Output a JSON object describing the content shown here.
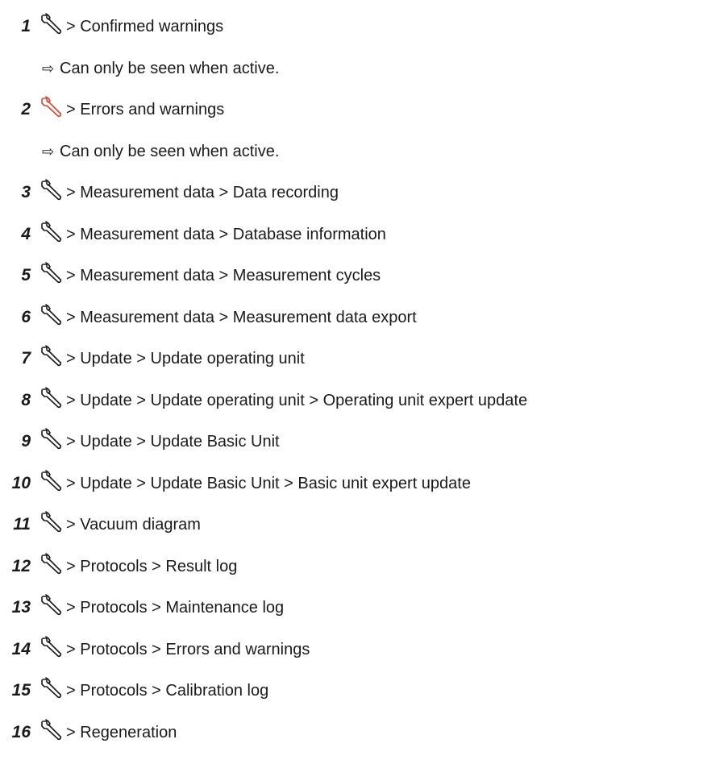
{
  "accent_color": "#d9442f",
  "icon_name": "wrench-icon",
  "separator": ">",
  "note_arrow": "⇨",
  "items": [
    {
      "number": "1",
      "path": "> Confirmed warnings",
      "highlight": false,
      "note": "Can only be seen when active."
    },
    {
      "number": "2",
      "path": "> Errors and warnings",
      "highlight": true,
      "note": "Can only be seen when active."
    },
    {
      "number": "3",
      "path": "> Measurement data > Data recording",
      "highlight": false
    },
    {
      "number": "4",
      "path": "> Measurement data > Database information",
      "highlight": false
    },
    {
      "number": "5",
      "path": "> Measurement data > Measurement cycles",
      "highlight": false
    },
    {
      "number": "6",
      "path": "> Measurement data > Measurement data export",
      "highlight": false
    },
    {
      "number": "7",
      "path": "> Update > Update operating unit",
      "highlight": false
    },
    {
      "number": "8",
      "path": "> Update > Update operating unit > Operating unit expert update",
      "highlight": false
    },
    {
      "number": "9",
      "path": "> Update > Update Basic Unit",
      "highlight": false
    },
    {
      "number": "10",
      "path": "> Update > Update Basic Unit > Basic unit expert update",
      "highlight": false
    },
    {
      "number": "11",
      "path": "> Vacuum diagram",
      "highlight": false
    },
    {
      "number": "12",
      "path": "> Protocols > Result log",
      "highlight": false
    },
    {
      "number": "13",
      "path": "> Protocols > Maintenance log",
      "highlight": false
    },
    {
      "number": "14",
      "path": "> Protocols > Errors and warnings",
      "highlight": false
    },
    {
      "number": "15",
      "path": "> Protocols > Calibration log",
      "highlight": false
    },
    {
      "number": "16",
      "path": "> Regeneration",
      "highlight": false
    }
  ]
}
